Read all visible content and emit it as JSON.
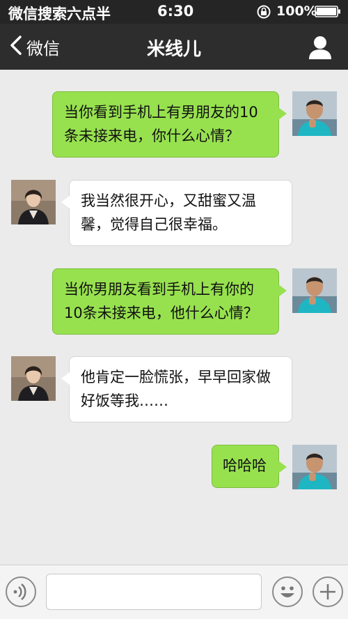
{
  "status_bar": {
    "carrier": "微信搜索六点半",
    "time": "6:30",
    "battery": "100%"
  },
  "nav": {
    "back_label": "微信",
    "title": "米线儿"
  },
  "messages": [
    {
      "side": "right",
      "text": "当你看到手机上有男朋友的10条未接来电，你什么心情？"
    },
    {
      "side": "left",
      "text": "我当然很开心，又甜蜜又温馨，觉得自己很幸福。"
    },
    {
      "side": "right",
      "text": "当你男朋友看到手机上有你的10条未接来电，他什么心情？"
    },
    {
      "side": "left",
      "text": "他肯定一脸慌张，早早回家做好饭等我……"
    },
    {
      "side": "right",
      "text": "哈哈哈"
    }
  ],
  "input": {
    "value": "",
    "placeholder": ""
  },
  "icons": {
    "voice": "voice-icon",
    "emoji": "emoji-icon",
    "add": "plus-icon"
  },
  "colors": {
    "own_bubble": "#97e14f",
    "other_bubble": "#ffffff",
    "nav_bg": "#2d2d2d",
    "background": "#ebebeb"
  }
}
